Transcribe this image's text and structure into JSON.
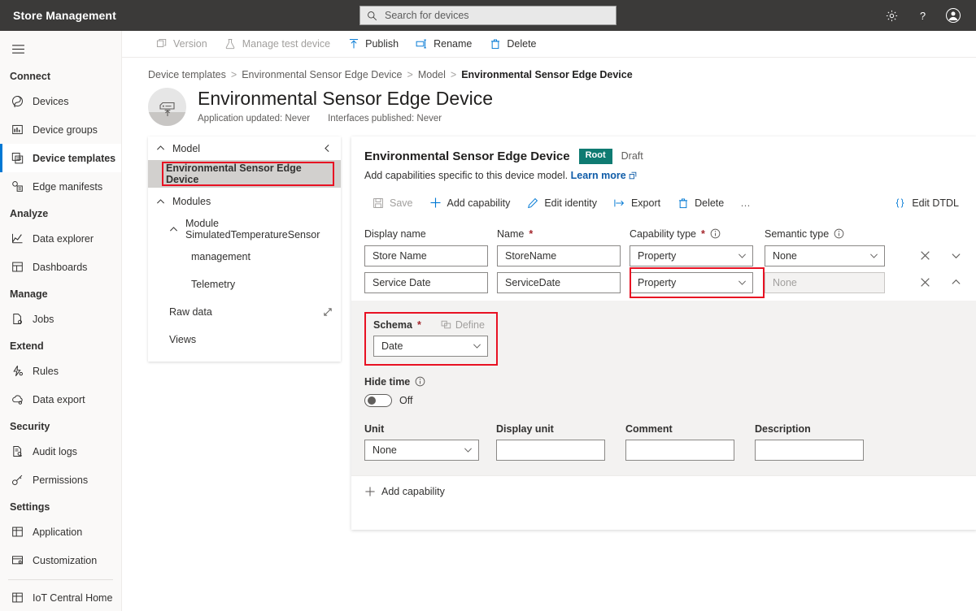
{
  "topbar": {
    "brand": "Store Management",
    "search_placeholder": "Search for devices",
    "search_value": "",
    "icons": {
      "settings": "gear-icon",
      "help": "help-icon",
      "account": "account-icon"
    }
  },
  "leftnav": {
    "groups": [
      {
        "label": "Connect",
        "items": [
          {
            "label": "Devices",
            "icon": "devices-icon",
            "selected": false
          },
          {
            "label": "Device groups",
            "icon": "device-groups-icon",
            "selected": false
          },
          {
            "label": "Device templates",
            "icon": "device-templates-icon",
            "selected": true
          },
          {
            "label": "Edge manifests",
            "icon": "edge-manifests-icon",
            "selected": false
          }
        ]
      },
      {
        "label": "Analyze",
        "items": [
          {
            "label": "Data explorer",
            "icon": "data-explorer-icon",
            "selected": false
          },
          {
            "label": "Dashboards",
            "icon": "dashboards-icon",
            "selected": false
          }
        ]
      },
      {
        "label": "Manage",
        "items": [
          {
            "label": "Jobs",
            "icon": "jobs-icon",
            "selected": false
          }
        ]
      },
      {
        "label": "Extend",
        "items": [
          {
            "label": "Rules",
            "icon": "rules-icon",
            "selected": false
          },
          {
            "label": "Data export",
            "icon": "data-export-icon",
            "selected": false
          }
        ]
      },
      {
        "label": "Security",
        "items": [
          {
            "label": "Audit logs",
            "icon": "audit-logs-icon",
            "selected": false
          },
          {
            "label": "Permissions",
            "icon": "permissions-icon",
            "selected": false
          }
        ]
      },
      {
        "label": "Settings",
        "items": [
          {
            "label": "Application",
            "icon": "application-icon",
            "selected": false
          },
          {
            "label": "Customization",
            "icon": "customization-icon",
            "selected": false
          }
        ]
      }
    ],
    "footer_item": {
      "label": "IoT Central Home",
      "icon": "iot-central-home-icon"
    }
  },
  "commandbar": [
    {
      "label": "Version",
      "icon": "version-icon",
      "disabled": true
    },
    {
      "label": "Manage test device",
      "icon": "flask-icon",
      "disabled": true
    },
    {
      "label": "Publish",
      "icon": "publish-icon",
      "disabled": false
    },
    {
      "label": "Rename",
      "icon": "rename-icon",
      "disabled": false
    },
    {
      "label": "Delete",
      "icon": "trash-icon",
      "disabled": false
    }
  ],
  "breadcrumb": {
    "items": [
      "Device templates",
      "Environmental Sensor Edge Device",
      "Model"
    ],
    "current": "Environmental Sensor Edge Device",
    "separator": ">"
  },
  "page": {
    "title": "Environmental Sensor Edge Device",
    "meta_updated": "Application updated: Never",
    "meta_published": "Interfaces published: Never"
  },
  "modelpane": {
    "header": "Model",
    "rows": [
      {
        "label": "Environmental Sensor Edge Device",
        "level": "model",
        "selected": true,
        "highlighted": true
      },
      {
        "label": "Modules",
        "level": "1",
        "chevron": "chevron-up-icon"
      },
      {
        "label": "Module SimulatedTemperatureSensor",
        "level": "2",
        "chevron": "chevron-up-icon"
      },
      {
        "label": "management",
        "level": "3"
      },
      {
        "label": "Telemetry",
        "level": "3"
      },
      {
        "label": "Raw data",
        "level": "2b",
        "trailing": "expand-icon"
      },
      {
        "label": "Views",
        "level": "2b"
      }
    ]
  },
  "editor": {
    "name": "Environmental Sensor Edge Device",
    "badge": "Root",
    "state": "Draft",
    "description": "Add capabilities specific to this device model.",
    "learn_more": "Learn more",
    "commands": [
      {
        "label": "Save",
        "icon": "save-icon",
        "disabled": true
      },
      {
        "label": "Add capability",
        "icon": "plus-icon",
        "disabled": false
      },
      {
        "label": "Edit identity",
        "icon": "pencil-icon",
        "disabled": false
      },
      {
        "label": "Export",
        "icon": "export-icon",
        "disabled": false
      },
      {
        "label": "Delete",
        "icon": "trash-icon",
        "disabled": false
      },
      {
        "label": "…",
        "icon": "more-icon",
        "disabled": false
      }
    ],
    "edit_dtdl": "Edit DTDL",
    "columns": {
      "display_name": "Display name",
      "name": "Name",
      "capability_type": "Capability type",
      "semantic_type": "Semantic type"
    },
    "rows": [
      {
        "display_name": "Store Name",
        "name": "StoreName",
        "capability_type": "Property",
        "semantic_type": "None",
        "semantic_disabled": false,
        "expanded": false,
        "chevron": "chevron-down-icon",
        "highlight_capability_type": false
      },
      {
        "display_name": "Service Date",
        "name": "ServiceDate",
        "capability_type": "Property",
        "semantic_type": "",
        "semantic_placeholder": "None",
        "semantic_disabled": true,
        "expanded": true,
        "chevron": "chevron-up-icon",
        "highlight_capability_type": true
      }
    ],
    "detail": {
      "schema_label": "Schema",
      "define_label": "Define",
      "schema_value": "Date",
      "hide_time_label": "Hide time",
      "hide_time_state": "Off",
      "unit_label": "Unit",
      "unit_value": "None",
      "display_unit_label": "Display unit",
      "display_unit_value": "",
      "comment_label": "Comment",
      "comment_value": "",
      "description_label": "Description",
      "description_value": ""
    },
    "add_capability": "Add capability"
  },
  "colors": {
    "topbar_bg": "#3b3a39",
    "accent": "#0078d4",
    "badge_teal": "#0f7b72",
    "highlight_red": "#e81123",
    "link": "#0f5ca8"
  }
}
